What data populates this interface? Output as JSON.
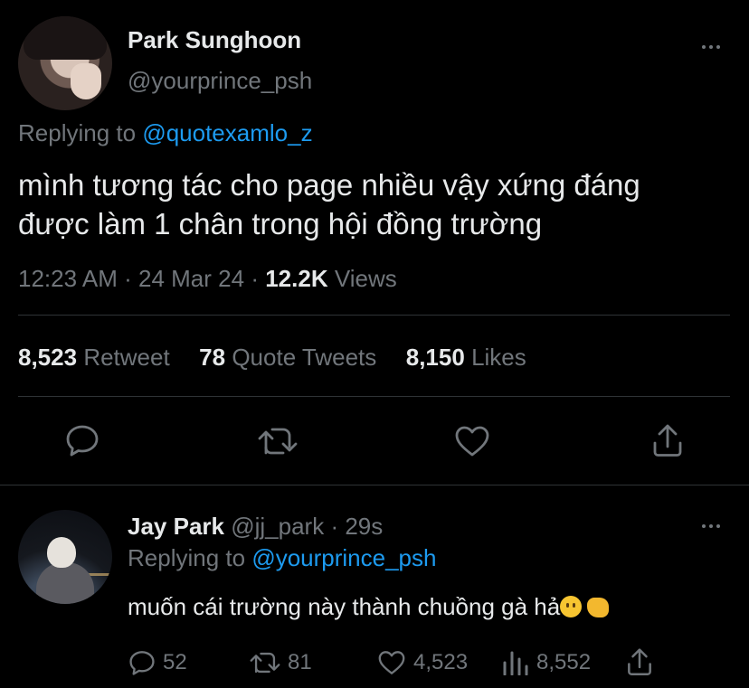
{
  "tweet": {
    "author_name": "Park Sunghoon",
    "author_handle": "@yourprince_psh",
    "replying_label": "Replying to",
    "replying_handle": "@quotexamlo_z",
    "text_line1": "mình tương tác cho page nhiều vậy xứng đáng",
    "text_line2": "được làm 1 chân trong hội đồng trường",
    "time": "12:23 AM",
    "sep1": "·",
    "date": "24 Mar 24",
    "sep2": "·",
    "views_count": "12.2K",
    "views_label": "Views",
    "retweets_count": "8,523",
    "retweets_label": "Retweet",
    "quotes_count": "78",
    "quotes_label": "Quote Tweets",
    "likes_count": "8,150",
    "likes_label": "Likes"
  },
  "reply": {
    "author_name": "Jay Park",
    "author_handle": "@jj_park",
    "sep": "·",
    "time": "29s",
    "replying_label": "Replying to",
    "replying_handle": "@yourprince_psh",
    "text": "muốn cái trường này thành chuồng gà hả",
    "replies": "52",
    "retweets": "81",
    "likes": "4,523",
    "views": "8,552"
  },
  "icons": [
    "more-icon",
    "reply-icon",
    "retweet-icon",
    "like-icon",
    "share-icon",
    "views-icon",
    "smile-emoji-icon",
    "fist-emoji-icon"
  ],
  "colors": {
    "background": "#000000",
    "text": "#e7e9ea",
    "muted": "#71767b",
    "link": "#1d9bf0"
  }
}
